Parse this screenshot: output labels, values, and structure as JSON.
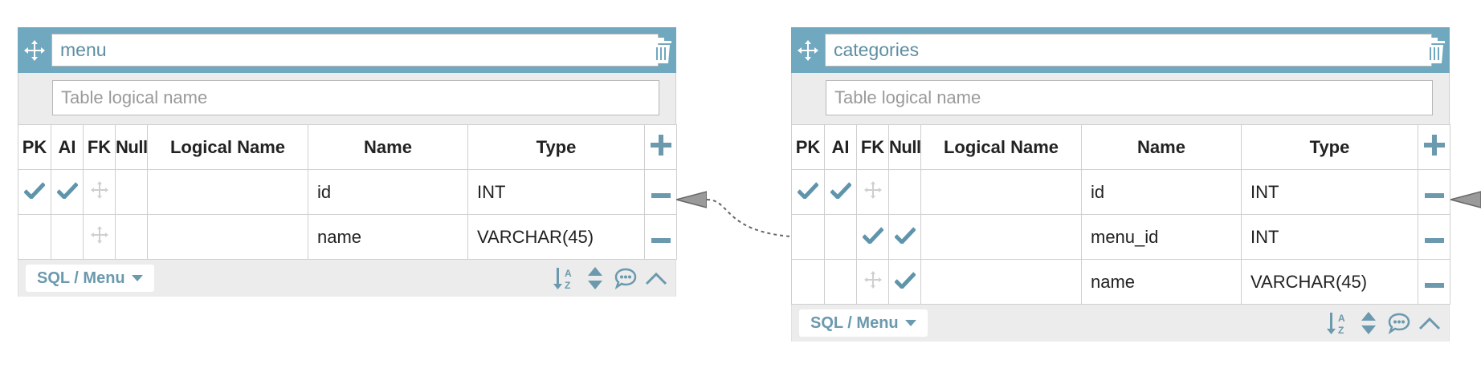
{
  "tables": [
    {
      "name": "menu",
      "logical_placeholder": "Table logical name",
      "headers": {
        "pk": "PK",
        "ai": "AI",
        "fk": "FK",
        "null": "Null",
        "logical": "Logical Name",
        "name": "Name",
        "type": "Type"
      },
      "columns": [
        {
          "name": "id",
          "type": "INT",
          "pk": true,
          "ai": true,
          "fk": false,
          "nullable": false
        },
        {
          "name": "name",
          "type": "VARCHAR(45)",
          "pk": false,
          "ai": false,
          "fk": false,
          "nullable": false
        }
      ],
      "menu_label": "SQL / Menu"
    },
    {
      "name": "categories",
      "logical_placeholder": "Table logical name",
      "headers": {
        "pk": "PK",
        "ai": "AI",
        "fk": "FK",
        "null": "Null",
        "logical": "Logical Name",
        "name": "Name",
        "type": "Type"
      },
      "columns": [
        {
          "name": "id",
          "type": "INT",
          "pk": true,
          "ai": true,
          "fk": false,
          "nullable": false
        },
        {
          "name": "menu_id",
          "type": "INT",
          "pk": false,
          "ai": false,
          "fk": true,
          "nullable": true
        },
        {
          "name": "name",
          "type": "VARCHAR(45)",
          "pk": false,
          "ai": false,
          "fk": false,
          "nullable": true
        }
      ],
      "menu_label": "SQL / Menu"
    }
  ],
  "icons": {
    "move": "move-icon",
    "trash": "trash-icon",
    "add": "plus-icon",
    "remove": "minus-icon",
    "check": "check-icon",
    "fk_handle": "fk-move-icon",
    "sort": "sort-az-icon",
    "updown": "up-down-icon",
    "comment": "comment-icon",
    "collapse": "chevron-up-icon"
  },
  "colors": {
    "header": "#6fa8bf",
    "accent": "#6b99ad",
    "check": "#5f95ab",
    "footer": "#ececec"
  }
}
